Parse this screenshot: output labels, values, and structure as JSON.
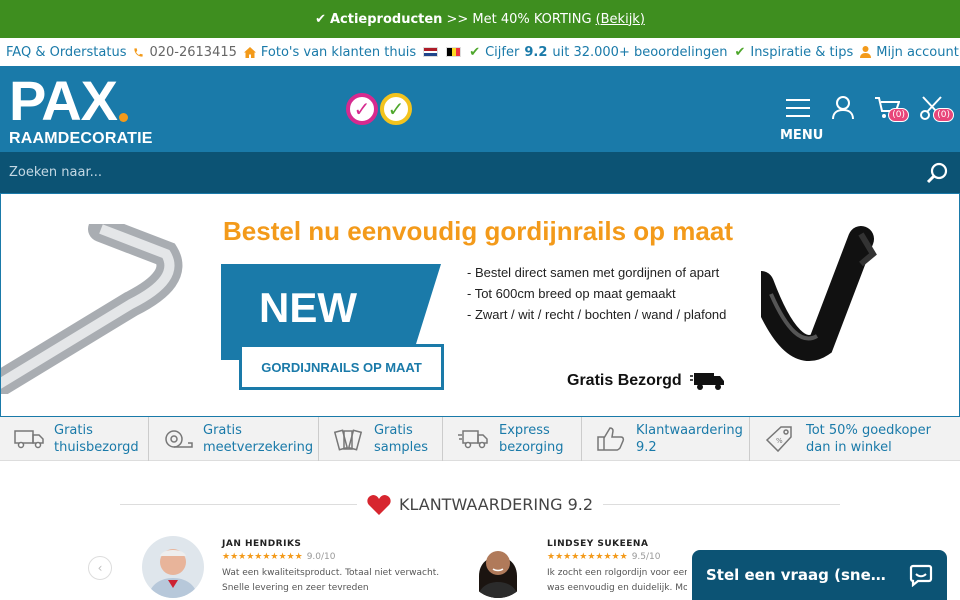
{
  "promo": {
    "check": "✔",
    "strong": "Actieproducten",
    "text": ">> Met 40% KORTING",
    "link": "(Bekijk)"
  },
  "toplinks": {
    "faq": "FAQ & Orderstatus",
    "phone": "020-2613415",
    "photos": "Foto's van klanten thuis",
    "rating_prefix": "Cijfer",
    "rating_score": "9.2",
    "rating_suffix": "uit 32.000+ beoordelingen",
    "inspiration": "Inspiratie & tips",
    "account": "Mijn account"
  },
  "header": {
    "logo_big": "PAX",
    "logo_sub": "RAAMDECORATIE",
    "menu_label": "MENU",
    "cart_count": "(0)",
    "samples_count": "(0)"
  },
  "search": {
    "placeholder": "Zoeken naar..."
  },
  "banner": {
    "title": "Bestel nu eenvoudig gordijnrails op maat",
    "new": "NEW",
    "tag": "GORDIJNRAILS OP MAAT",
    "bullets": [
      "- Bestel direct samen met gordijnen of apart",
      "- Tot 600cm breed op maat gemaakt",
      "- Zwart / wit / recht / bochten / wand / plafond"
    ],
    "gratis": "Gratis Bezorgd"
  },
  "usps": [
    {
      "l1": "Gratis",
      "l2": "thuisbezorgd",
      "icon": "truck-icon"
    },
    {
      "l1": "Gratis",
      "l2": "meetverzekering",
      "icon": "tape-measure-icon"
    },
    {
      "l1": "Gratis",
      "l2": "samples",
      "icon": "swatches-icon"
    },
    {
      "l1": "Express",
      "l2": "bezorging",
      "icon": "fast-truck-icon"
    },
    {
      "l1": "Klantwaardering",
      "l2": "9.2",
      "icon": "thumbs-up-icon"
    },
    {
      "l1": "Tot 50% goedkoper",
      "l2": "dan in winkel",
      "icon": "price-tag-icon"
    }
  ],
  "reviews": {
    "heading": "KLANTWAARDERING 9.2",
    "items": [
      {
        "name": "JAN HENDRIKS",
        "stars": "★★★★★★★★★★",
        "score": "9.0/10",
        "line1": "Wat een kwaliteitsproduct. Totaal niet verwacht.",
        "line2": "Snelle levering en zeer tevreden"
      },
      {
        "name": "LINDSEY SUKEENA",
        "stars": "★★★★★★★★★★",
        "score": "9.5/10",
        "line1": "Ik zocht een rolgordijn voor een e",
        "line2": "was eenvoudig en duidelijk. Mont"
      }
    ]
  },
  "chat": {
    "label": "Stel een vraag (snel antwoord)"
  },
  "colors": {
    "brand_blue": "#1a7aa9",
    "dark_blue": "#0c5374",
    "promo_green": "#3e8e1f",
    "orange": "#f39a1a"
  }
}
